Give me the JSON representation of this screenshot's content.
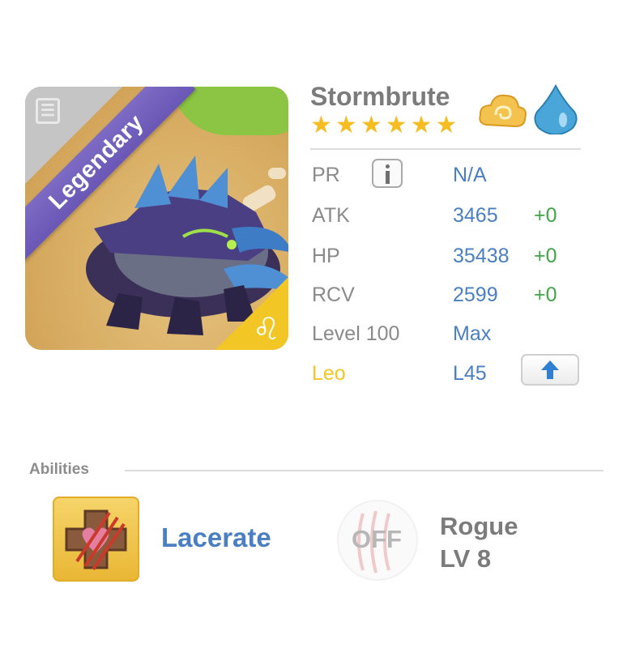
{
  "monster": {
    "name": "Stormbrute",
    "rarity": "Legendary",
    "star_count": 6,
    "element_icons": [
      "cloud-icon",
      "water-drop-icon"
    ],
    "zodiac_glyph": "♌"
  },
  "stats": {
    "pr": {
      "label": "PR",
      "value": "N/A"
    },
    "atk": {
      "label": "ATK",
      "value": "3465",
      "bonus": "+0"
    },
    "hp": {
      "label": "HP",
      "value": "35438",
      "bonus": "+0"
    },
    "rcv": {
      "label": "RCV",
      "value": "2599",
      "bonus": "+0"
    },
    "level": {
      "label": "Level 100",
      "value": "Max"
    },
    "zodiac": {
      "label": "Leo",
      "value": "L45"
    }
  },
  "abilities": {
    "title": "Abilities",
    "primary": {
      "name": "Lacerate"
    },
    "class_ability": {
      "state": "OFF",
      "name": "Rogue",
      "level": "LV 8"
    }
  },
  "colors": {
    "accent_blue": "#4a7fc1",
    "bonus_green": "#3fa547",
    "star_gold": "#f6bd23",
    "legendary_purple": "#6a57b6",
    "zodiac_yellow": "#f2c624"
  }
}
